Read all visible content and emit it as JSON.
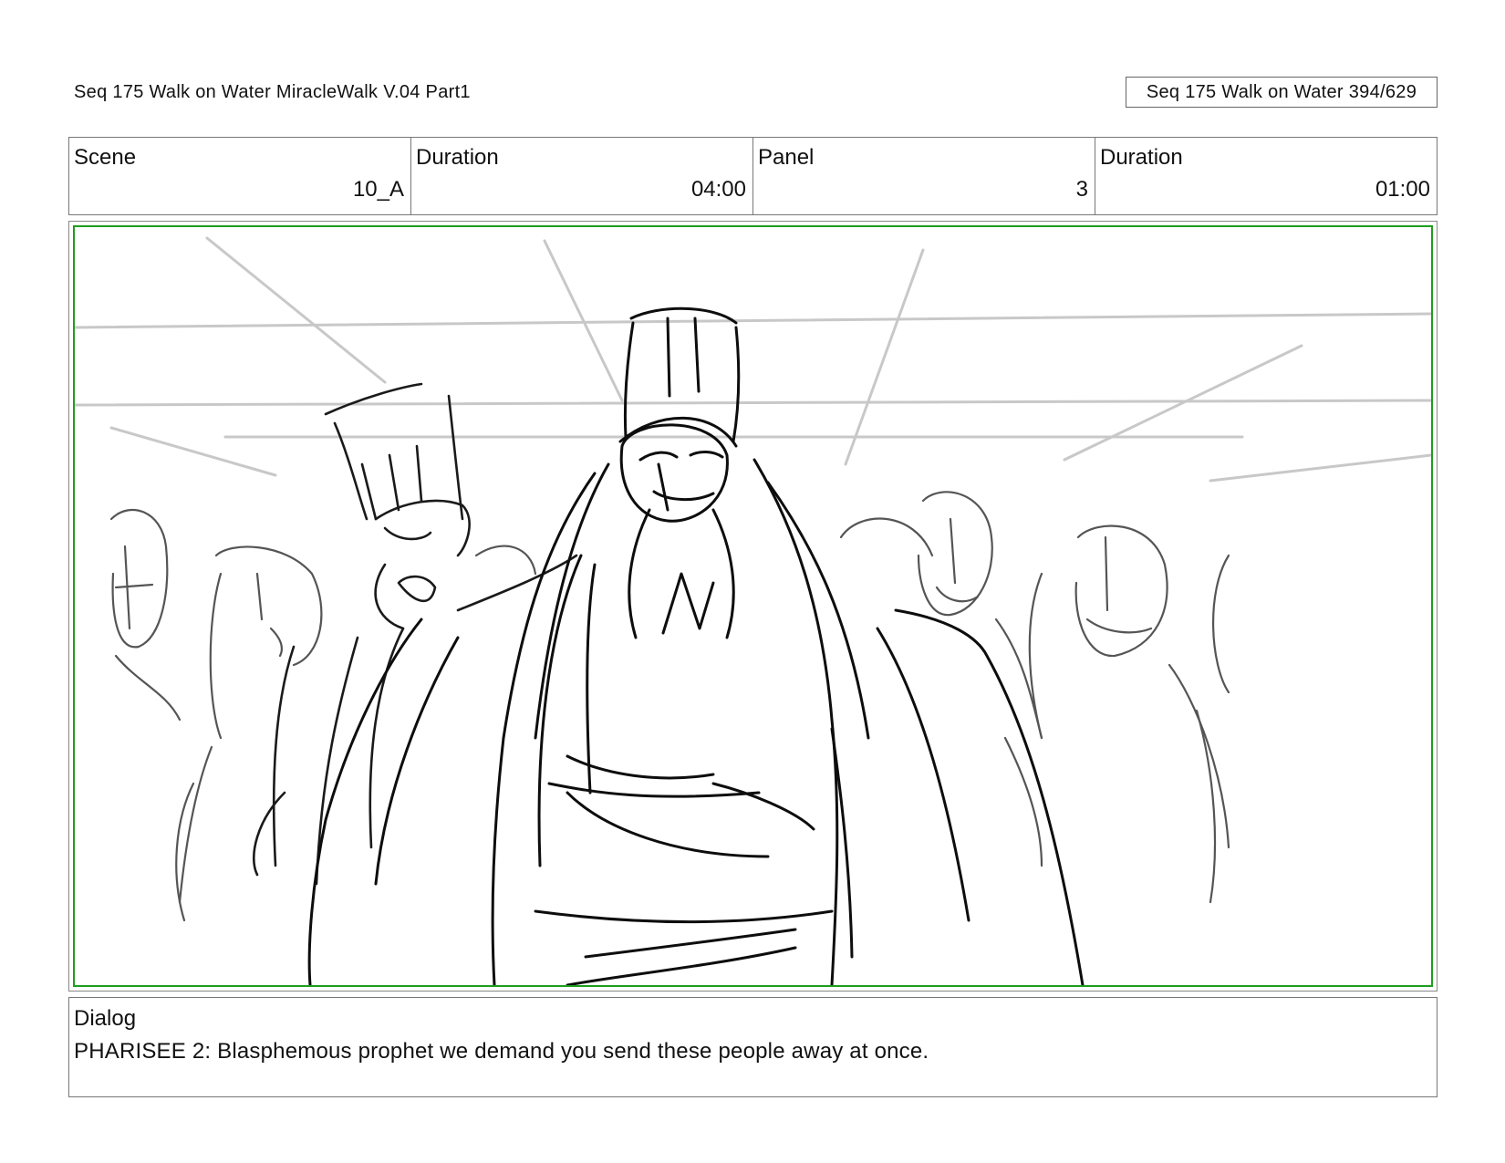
{
  "header": {
    "document_title": "Seq 175 Walk on Water  MiracleWalk V.04 Part1",
    "page_ref": "Seq 175 Walk on Water 394/629"
  },
  "info": {
    "scene_label": "Scene",
    "scene_value": "10_A",
    "scene_duration_label": "Duration",
    "scene_duration_value": "04:00",
    "panel_label": "Panel",
    "panel_value": "3",
    "panel_duration_label": "Duration",
    "panel_duration_value": "01:00"
  },
  "panel": {
    "frame_color": "#1e9e1e"
  },
  "dialog": {
    "label": "Dialog",
    "text": "PHARISEE 2: Blasphemous prophet we demand you send these people away at once."
  }
}
